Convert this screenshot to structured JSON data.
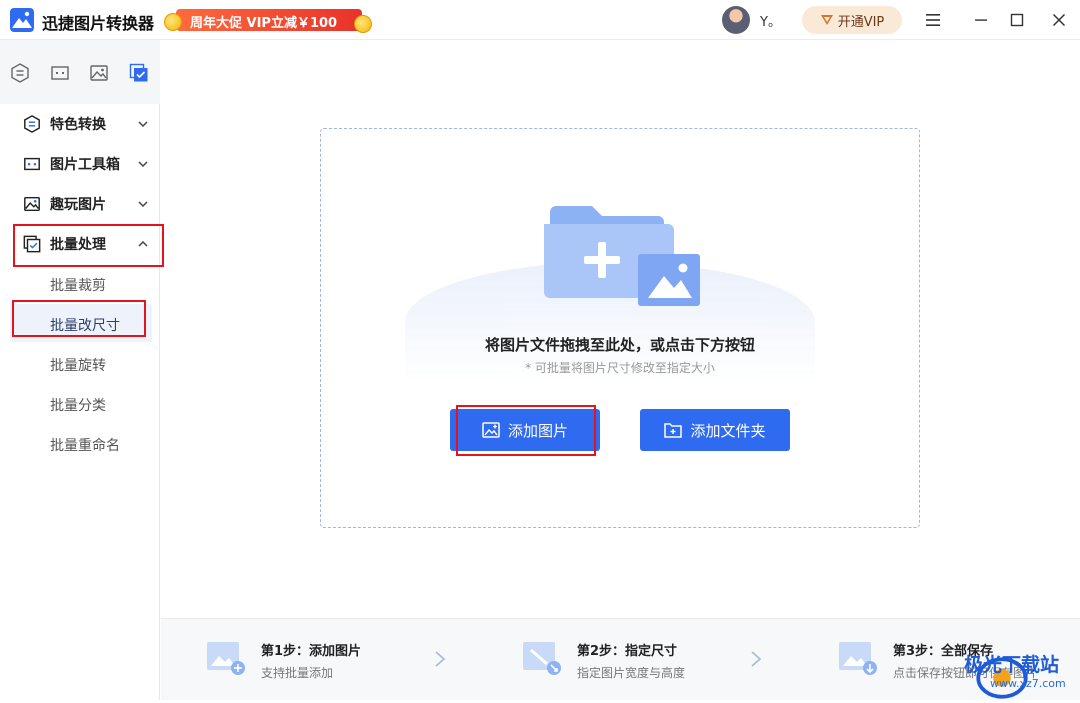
{
  "app": {
    "title": "迅捷图片转换器"
  },
  "promo": {
    "text": "周年大促 VIP立减￥100"
  },
  "user": {
    "name": "Y。"
  },
  "vip_button": {
    "label": "开通VIP"
  },
  "sidebar": {
    "groups": [
      {
        "label": "特色转换",
        "expanded": false
      },
      {
        "label": "图片工具箱",
        "expanded": false
      },
      {
        "label": "趣玩图片",
        "expanded": false
      },
      {
        "label": "批量处理",
        "expanded": true
      }
    ],
    "batch_items": [
      "批量裁剪",
      "批量改尺寸",
      "批量旋转",
      "批量分类",
      "批量重命名"
    ],
    "active_item": "批量改尺寸"
  },
  "dropzone": {
    "title": "将图片文件拖拽至此处，或点击下方按钮",
    "subtitle": "* 可批量将图片尺寸修改至指定大小",
    "add_image_label": "添加图片",
    "add_folder_label": "添加文件夹"
  },
  "steps": [
    {
      "title": "第1步：添加图片",
      "desc": "支持批量添加"
    },
    {
      "title": "第2步：指定尺寸",
      "desc": "指定图片宽度与高度"
    },
    {
      "title": "第3步：全部保存",
      "desc": "点击保存按钮即可保存图片"
    }
  ],
  "watermark": {
    "text": "极光下载站",
    "url": "www.xz7.com"
  },
  "colors": {
    "accent": "#2f6bf0",
    "highlight": "#e3141b",
    "promo": "#e8322a"
  }
}
